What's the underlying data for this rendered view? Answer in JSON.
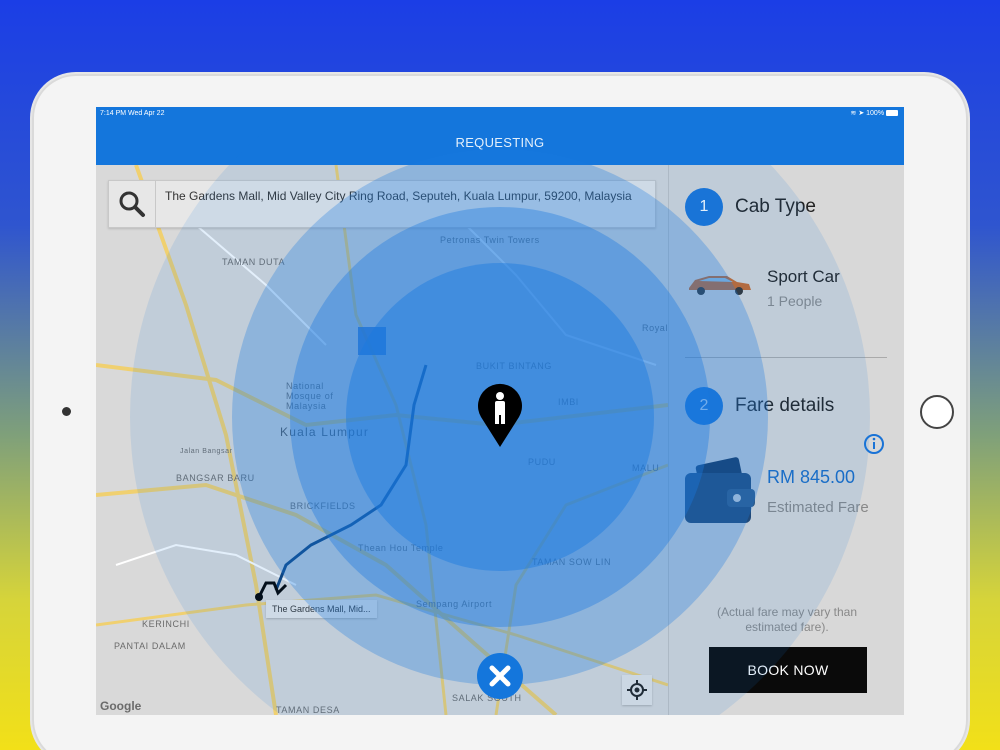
{
  "status_bar": {
    "time": "7:14 PM  Wed Apr 22",
    "battery": "100%"
  },
  "nav": {
    "title": "REQUESTING"
  },
  "search": {
    "address": "The Gardens Mall, Mid Valley City Ring Road, Seputeh, Kuala Lumpur, 59200, Malaysia"
  },
  "map": {
    "labels": {
      "taman_duta": "TAMAN DUTA",
      "kuala_lumpur": "Kuala Lumpur",
      "bangsar_baru": "BANGSAR BARU",
      "brickfields": "BRICKFIELDS",
      "kerinchi": "KERINCHI",
      "pantai_dalam": "PANTAI DALAM",
      "taman_desa": "TAMAN DESA",
      "bukit_bintang": "BUKIT BINTANG",
      "imbi": "IMBI",
      "pudu": "PUDU",
      "malu": "MALU",
      "salak_south": "SALAK SOUTH",
      "taman_sow_lin": "TAMAN SOW LIN",
      "petronas": "Petronas Twin Towers",
      "sempang_airport": "Sempang Airport",
      "thean_hou": "Thean Hou Temple",
      "jalan_bangsar": "Jalan Bangsar",
      "royal": "Royal",
      "national_mosque": "National Mosque of Malaysia"
    },
    "route_callout": "The Gardens Mall, Mid...",
    "google": "Google"
  },
  "panel": {
    "step1": {
      "number": "1",
      "title": "Cab Type"
    },
    "car": {
      "name": "Sport Car",
      "people": "1 People"
    },
    "step2": {
      "number": "2",
      "title": "Fare details"
    },
    "fare": {
      "amount": "RM 845.00",
      "label": "Estimated Fare"
    },
    "note": "(Actual fare may vary than estimated fare).",
    "book_label": "BOOK NOW"
  },
  "colors": {
    "accent": "#1476dc",
    "pulse": "#1a7ae0"
  }
}
